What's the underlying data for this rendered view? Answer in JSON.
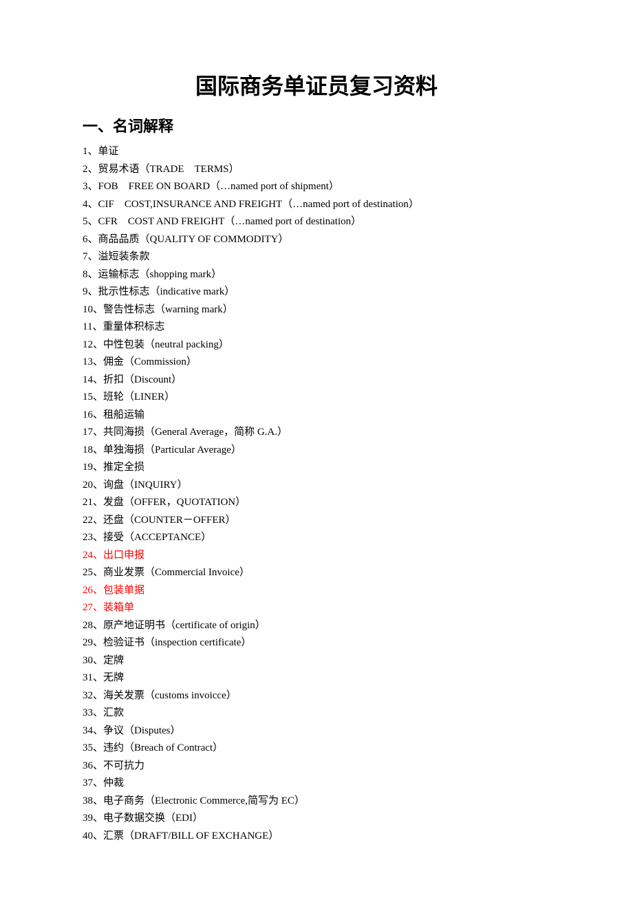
{
  "title": "国际商务单证员复习资料",
  "section_heading": "一、名词解释",
  "items": [
    {
      "text": "1、单证",
      "red": false
    },
    {
      "text": "2、贸易术语（TRADE　TERMS）",
      "red": false
    },
    {
      "text": "3、FOB　FREE ON BOARD（…named port of shipment）",
      "red": false
    },
    {
      "text": "4、CIF　COST,INSURANCE AND FREIGHT（…named port of destination）",
      "red": false
    },
    {
      "text": "5、CFR　COST AND FREIGHT（…named port of destination）",
      "red": false
    },
    {
      "text": "6、商品品质（QUALITY OF COMMODITY）",
      "red": false
    },
    {
      "text": "7、溢短装条款",
      "red": false
    },
    {
      "text": "8、运输标志（shopping mark）",
      "red": false
    },
    {
      "text": "9、批示性标志（indicative mark）",
      "red": false
    },
    {
      "text": "10、警告性标志（warning mark）",
      "red": false
    },
    {
      "text": "11、重量体积标志",
      "red": false
    },
    {
      "text": "12、中性包装（neutral packing）",
      "red": false
    },
    {
      "text": "13、佣金（Commission）",
      "red": false
    },
    {
      "text": "14、折扣（Discount）",
      "red": false
    },
    {
      "text": "15、班轮（LINER）",
      "red": false
    },
    {
      "text": "16、租船运输",
      "red": false
    },
    {
      "text": "17、共同海损（General Average，简称 G.A.）",
      "red": false
    },
    {
      "text": "18、单独海损（Particular Average）",
      "red": false
    },
    {
      "text": "19、推定全损",
      "red": false
    },
    {
      "text": "20、询盘（INQUIRY）",
      "red": false
    },
    {
      "text": "21、发盘（OFFER，QUOTATION）",
      "red": false
    },
    {
      "text": "22、还盘（COUNTER－OFFER）",
      "red": false
    },
    {
      "text": "23、接受（ACCEPTANCE）",
      "red": false
    },
    {
      "text": "24、出口申报",
      "red": true
    },
    {
      "text": "25、商业发票（Commercial Invoice）",
      "red": false
    },
    {
      "text": "26、包装单据",
      "red": true
    },
    {
      "text": "27、装箱单",
      "red": true
    },
    {
      "text": "28、原产地证明书（certificate of origin）",
      "red": false
    },
    {
      "text": "29、检验证书（inspection certificate）",
      "red": false
    },
    {
      "text": "30、定牌",
      "red": false
    },
    {
      "text": "31、无牌",
      "red": false
    },
    {
      "text": "32、海关发票（customs invoicce）",
      "red": false
    },
    {
      "text": "33、汇款",
      "red": false
    },
    {
      "text": "34、争议（Disputes）",
      "red": false
    },
    {
      "text": "35、违约（Breach of Contract）",
      "red": false
    },
    {
      "text": "36、不可抗力",
      "red": false
    },
    {
      "text": "37、仲裁",
      "red": false
    },
    {
      "text": "38、电子商务（Electronic Commerce,简写为 EC）",
      "red": false
    },
    {
      "text": "39、电子数据交换（EDI）",
      "red": false
    },
    {
      "text": "40、汇票（DRAFT/BILL OF EXCHANGE）",
      "red": false
    }
  ]
}
